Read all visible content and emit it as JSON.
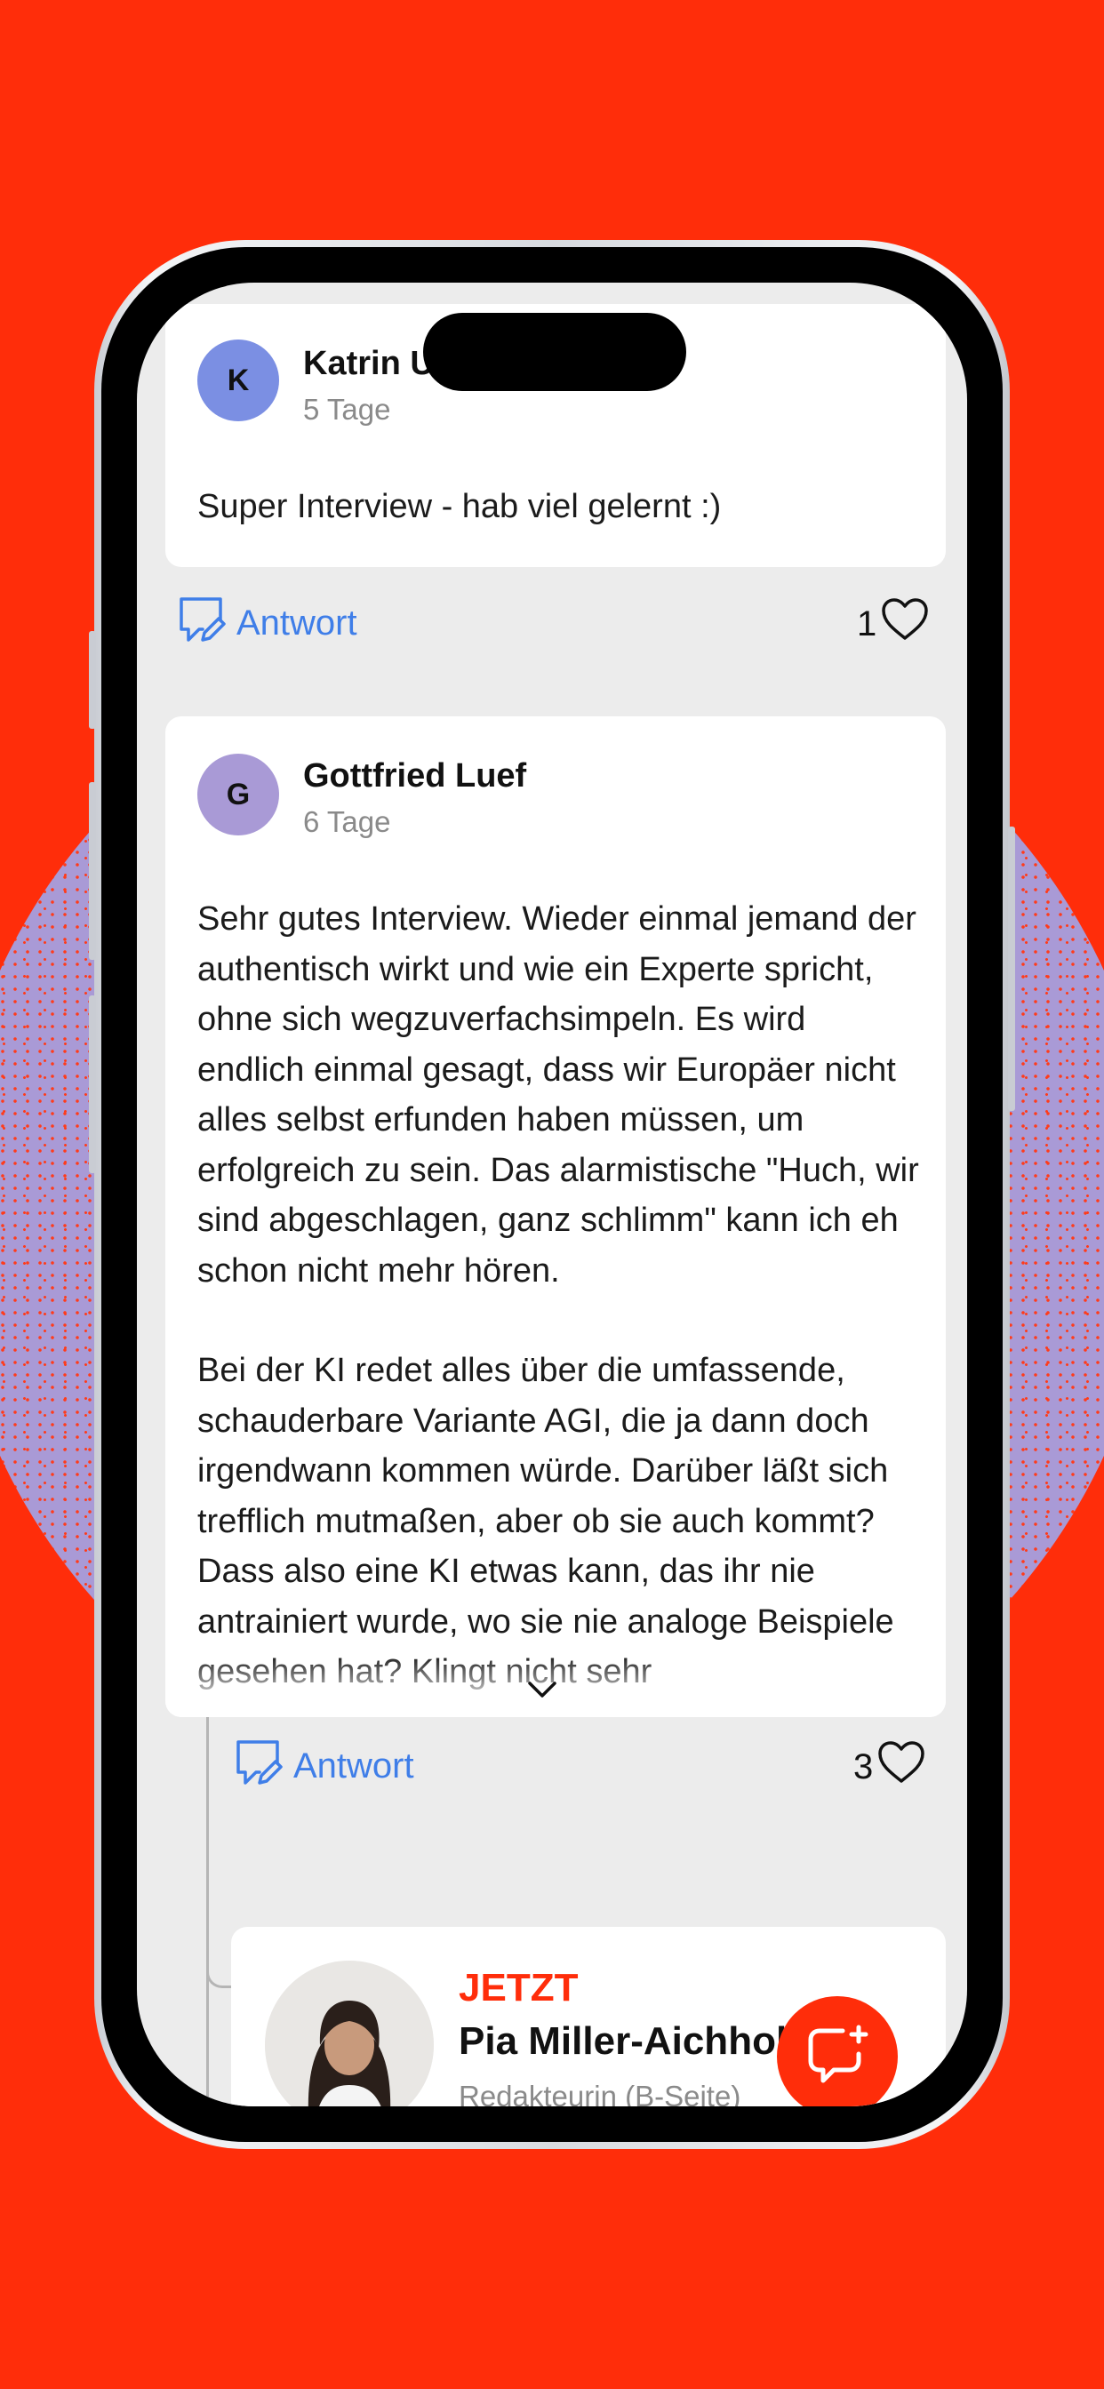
{
  "colors": {
    "brand_red": "#ff2d0a",
    "link_blue": "#3f7ee8",
    "avatar_k": "#7b8fe3",
    "avatar_g": "#a99ad6"
  },
  "comments": [
    {
      "initial": "K",
      "author": "Katrin U",
      "time": "5 Tage",
      "text": "Super Interview - hab viel gelernt :)",
      "reply_label": "Antwort",
      "likes": "1"
    },
    {
      "initial": "G",
      "author": "Gottfried Luef",
      "time": "6 Tage",
      "text_p1": "Sehr gutes Interview. Wieder einmal jemand der authentisch wirkt und wie ein Experte spricht, ohne sich wegzuverfachsimpeln. Es wird endlich einmal gesagt, dass wir Europäer nicht alles selbst erfunden haben müssen, um erfolgreich zu sein. Das alarmistische \"Huch, wir sind abgeschlagen, ganz schlimm\" kann ich eh schon nicht mehr hören.",
      "text_p2": "Bei der KI redet alles über die umfassende, schauderbare Variante AGI, die ja dann doch irgendwann kommen würde. Darüber läßt sich trefflich mutmaßen, aber ob sie auch kommt? Dass also eine KI etwas kann, das ihr nie antrainiert wurde, wo sie nie analoge Beispiele gesehen hat? Klingt nicht sehr",
      "reply_label": "Antwort",
      "likes": "3"
    }
  ],
  "editor": {
    "badge": "JETZT",
    "name": "Pia Miller-Aichholz",
    "role": "Redakteurin (B-Seite)"
  },
  "icons": {
    "reply": "reply-bubble-pencil-icon",
    "like": "heart-outline-icon",
    "expand": "chevron-down-icon",
    "fab": "chat-sparkle-icon"
  }
}
